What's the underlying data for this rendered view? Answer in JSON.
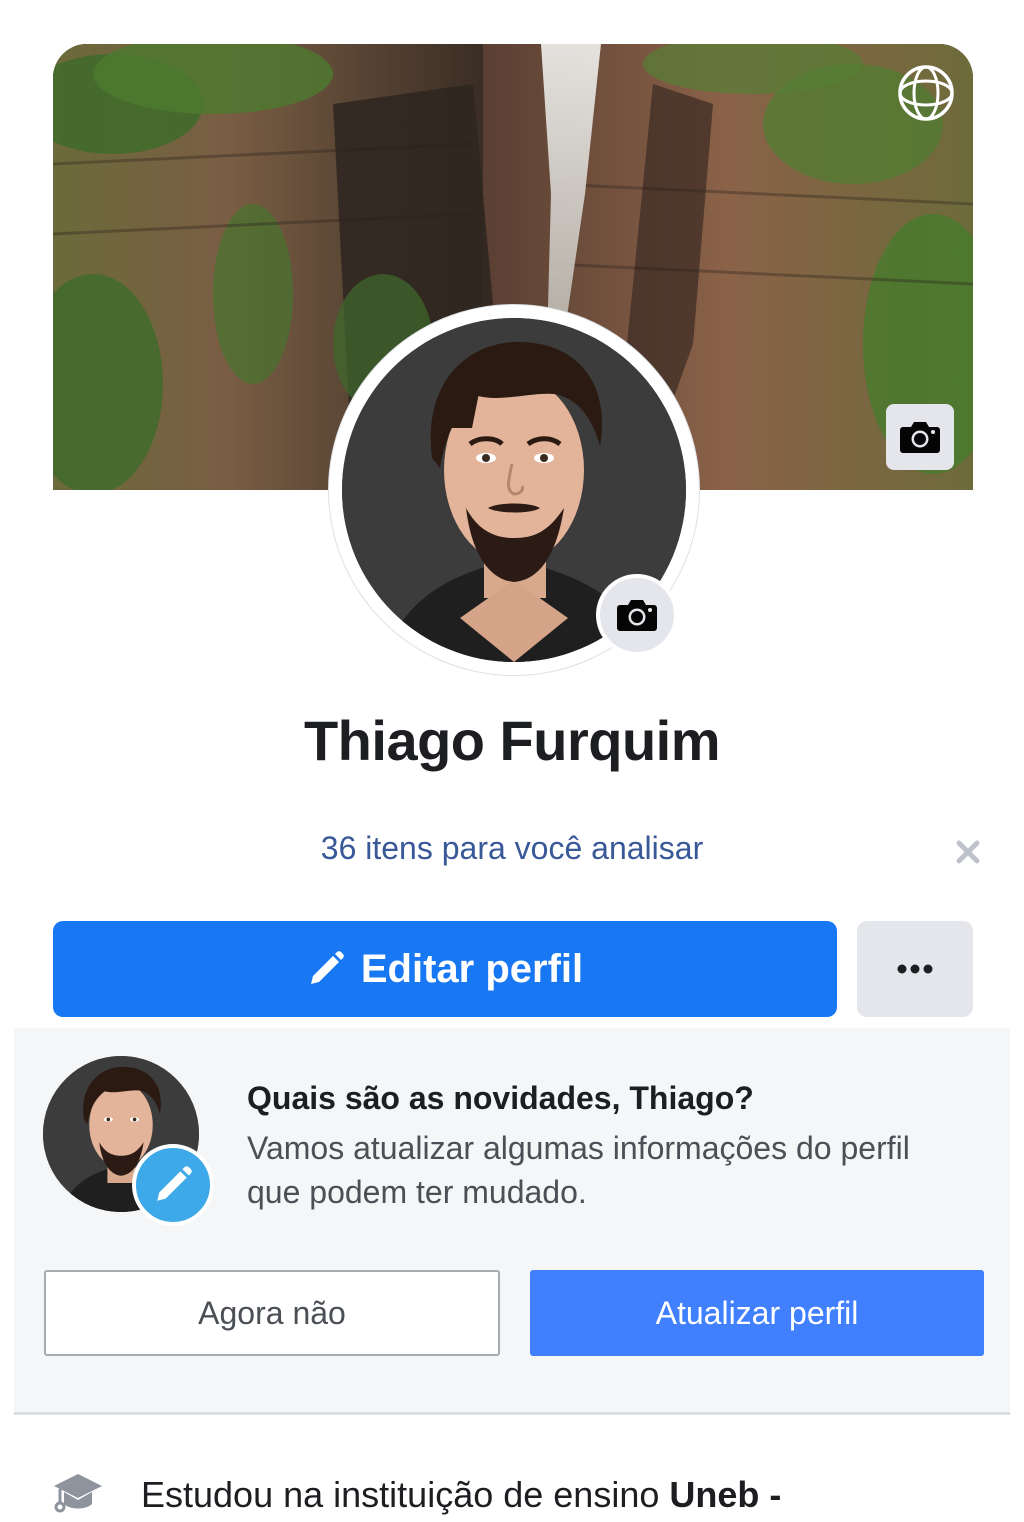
{
  "profile": {
    "name": "Thiago Furquim",
    "review_notice": "36 itens para você analisar"
  },
  "actions": {
    "edit_profile_label": "Editar perfil"
  },
  "update_prompt": {
    "title": "Quais são as novidades, Thiago?",
    "body": "Vamos atualizar algumas informações do perfil que podem ter mudado.",
    "not_now_label": "Agora não",
    "update_label": "Atualizar perfil"
  },
  "education": {
    "prefix": "Estudou na instituição de ensino ",
    "school": "Uneb -"
  },
  "colors": {
    "primary_blue": "#1877f2",
    "update_blue": "#4080ff",
    "link_blue": "#385898",
    "pencil_badge": "#3ea9e8"
  },
  "icons": {
    "cover_360": "sphere-360-icon",
    "cover_camera": "camera-icon",
    "avatar_camera": "camera-icon",
    "close": "close-icon",
    "edit": "pencil-icon",
    "more": "more-dots-icon",
    "education": "graduation-cap-icon"
  }
}
